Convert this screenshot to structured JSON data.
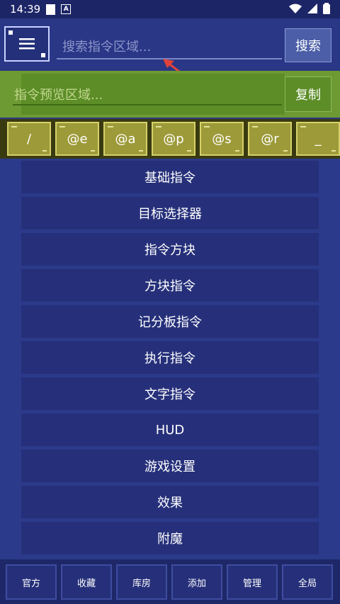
{
  "status": {
    "time": "14:39"
  },
  "header": {
    "search_placeholder": "搜索指令区域...",
    "search_label": "搜索"
  },
  "preview": {
    "placeholder": "指令预览区域...",
    "copy_label": "复制"
  },
  "selectors": [
    "/",
    "@e",
    "@a",
    "@p",
    "@s",
    "@r",
    "_"
  ],
  "categories": [
    "基础指令",
    "目标选择器",
    "指令方块",
    "方块指令",
    "记分板指令",
    "执行指令",
    "文字指令",
    "HUD",
    "游戏设置",
    "效果",
    "附魔"
  ],
  "bottom_tabs": [
    "官方",
    "收藏",
    "库房",
    "添加",
    "管理",
    "全局"
  ],
  "colors": {
    "background": "#2b3a8a",
    "preview_green": "#6e9a33",
    "selector_yellow": "#9d9a39",
    "arrow_red": "#e0423a"
  }
}
